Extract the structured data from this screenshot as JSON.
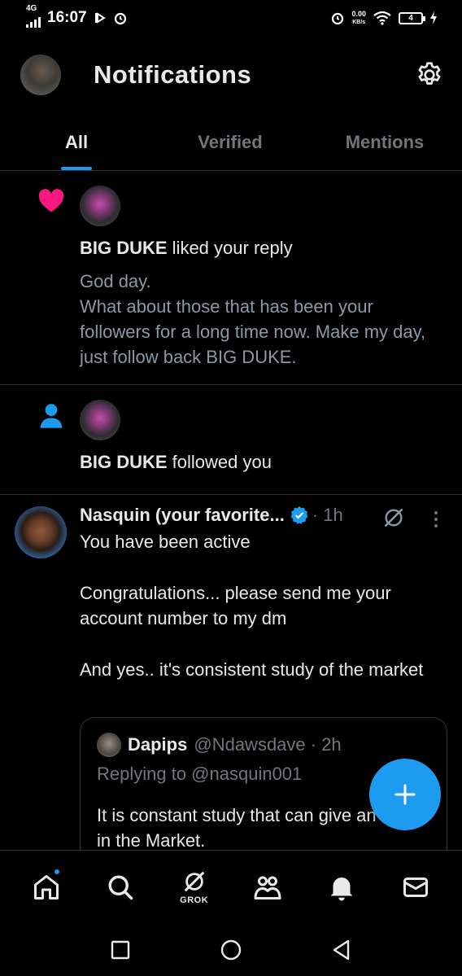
{
  "status_bar": {
    "network": "4G",
    "time": "16:07",
    "speed_value": "0.00",
    "speed_unit": "KB/s",
    "battery": "4"
  },
  "header": {
    "title": "Notifications",
    "settings_icon": "gear-icon"
  },
  "tabs": [
    {
      "label": "All",
      "active": true
    },
    {
      "label": "Verified",
      "active": false
    },
    {
      "label": "Mentions",
      "active": false
    }
  ],
  "notifications": [
    {
      "type": "like",
      "icon": "heart-icon",
      "user": "BIG DUKE",
      "action": " liked your reply",
      "text_line1": "God day.",
      "text_line2": "What about those that has been your followers for a long time now. Make my day, just follow back BIG DUKE."
    },
    {
      "type": "follow",
      "icon": "person-icon",
      "user": "BIG DUKE",
      "action": " followed you"
    },
    {
      "type": "reply",
      "user": "Nasquin (your favorite...",
      "time": "· 1h",
      "para1": "You have been active",
      "para2": "Congratulations... please send me your account number to my dm",
      "para3": "And yes.. it's consistent study of the market",
      "quote": {
        "name": "Dapips",
        "handle": "@Ndawsdave · 2h",
        "replying": "Replying to @nasquin001",
        "text": "It is constant study that can give an edge in the Market."
      }
    }
  ],
  "bottom_nav": {
    "items": [
      "home-icon",
      "search-icon",
      "grok-icon",
      "communities-icon",
      "notifications-bell-icon",
      "messages-mail-icon"
    ],
    "grok_label": "GROK"
  },
  "colors": {
    "accent": "#1d9bf0",
    "like": "#f91880",
    "text": "#e7e9ea",
    "muted": "#71767b",
    "divider": "#2f3336"
  }
}
